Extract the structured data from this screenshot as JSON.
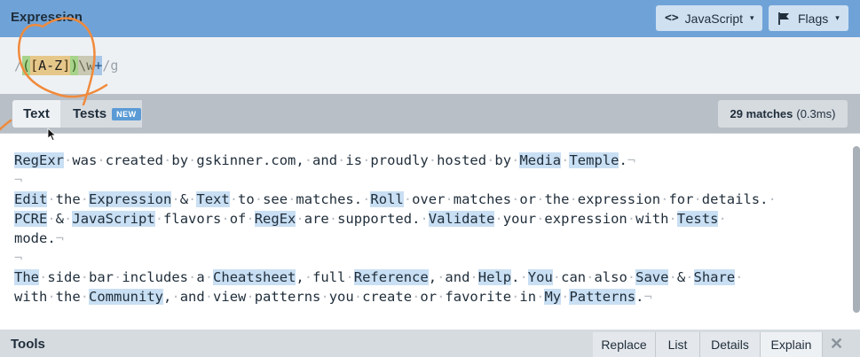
{
  "header": {
    "title": "Expression",
    "language_icon": "code-icon",
    "language_label": "JavaScript",
    "flags_icon": "flag-icon",
    "flags_label": "Flags",
    "caret": "▾"
  },
  "expression": {
    "open_delim": "/",
    "group_open": "(",
    "set_open": "[",
    "range": "A-Z",
    "set_close": "]",
    "group_close": ")",
    "word_class": "\\w",
    "quantifier": "+",
    "close_delim": "/g"
  },
  "tabs": {
    "text": "Text",
    "tests": "Tests",
    "tests_badge": "NEW",
    "match_count": "29 matches",
    "match_time": "(0.3ms)"
  },
  "text_lines": [
    [
      {
        "t": "RegExr",
        "h": true
      },
      {
        "t": "·"
      },
      {
        "t": "was"
      },
      {
        "t": "·"
      },
      {
        "t": "created"
      },
      {
        "t": "·"
      },
      {
        "t": "by"
      },
      {
        "t": "·"
      },
      {
        "t": "gskinner.com,"
      },
      {
        "t": "·"
      },
      {
        "t": "and"
      },
      {
        "t": "·"
      },
      {
        "t": "is"
      },
      {
        "t": "·"
      },
      {
        "t": "proudly"
      },
      {
        "t": "·"
      },
      {
        "t": "hosted"
      },
      {
        "t": "·"
      },
      {
        "t": "by"
      },
      {
        "t": "·"
      },
      {
        "t": "Media",
        "h": true
      },
      {
        "t": "·"
      },
      {
        "t": "Temple",
        "h": true
      },
      {
        "t": "."
      },
      {
        "t": "¬",
        "w": true
      }
    ],
    [
      {
        "t": "¬",
        "w": true
      }
    ],
    [
      {
        "t": "Edit",
        "h": true
      },
      {
        "t": "·"
      },
      {
        "t": "the"
      },
      {
        "t": "·"
      },
      {
        "t": "Expression",
        "h": true
      },
      {
        "t": "·"
      },
      {
        "t": "&"
      },
      {
        "t": "·"
      },
      {
        "t": "Text",
        "h": true
      },
      {
        "t": "·"
      },
      {
        "t": "to"
      },
      {
        "t": "·"
      },
      {
        "t": "see"
      },
      {
        "t": "·"
      },
      {
        "t": "matches."
      },
      {
        "t": "·"
      },
      {
        "t": "Roll",
        "h": true
      },
      {
        "t": "·"
      },
      {
        "t": "over"
      },
      {
        "t": "·"
      },
      {
        "t": "matches"
      },
      {
        "t": "·"
      },
      {
        "t": "or"
      },
      {
        "t": "·"
      },
      {
        "t": "the"
      },
      {
        "t": "·"
      },
      {
        "t": "expression"
      },
      {
        "t": "·"
      },
      {
        "t": "for"
      },
      {
        "t": "·"
      },
      {
        "t": "details."
      },
      {
        "t": "·"
      }
    ],
    [
      {
        "t": "PCRE",
        "h": true
      },
      {
        "t": "·"
      },
      {
        "t": "&"
      },
      {
        "t": "·"
      },
      {
        "t": "JavaScript",
        "h": true
      },
      {
        "t": "·"
      },
      {
        "t": "flavors"
      },
      {
        "t": "·"
      },
      {
        "t": "of"
      },
      {
        "t": "·"
      },
      {
        "t": "RegEx",
        "h": true
      },
      {
        "t": "·"
      },
      {
        "t": "are"
      },
      {
        "t": "·"
      },
      {
        "t": "supported."
      },
      {
        "t": "·"
      },
      {
        "t": "Validate",
        "h": true
      },
      {
        "t": "·"
      },
      {
        "t": "your"
      },
      {
        "t": "·"
      },
      {
        "t": "expression"
      },
      {
        "t": "·"
      },
      {
        "t": "with"
      },
      {
        "t": "·"
      },
      {
        "t": "Tests",
        "h": true
      },
      {
        "t": "·"
      }
    ],
    [
      {
        "t": "mode."
      },
      {
        "t": "¬",
        "w": true
      }
    ],
    [
      {
        "t": "¬",
        "w": true
      }
    ],
    [
      {
        "t": "The",
        "h": true
      },
      {
        "t": "·"
      },
      {
        "t": "side"
      },
      {
        "t": "·"
      },
      {
        "t": "bar"
      },
      {
        "t": "·"
      },
      {
        "t": "includes"
      },
      {
        "t": "·"
      },
      {
        "t": "a"
      },
      {
        "t": "·"
      },
      {
        "t": "Cheatsheet",
        "h": true
      },
      {
        "t": ","
      },
      {
        "t": "·"
      },
      {
        "t": "full"
      },
      {
        "t": "·"
      },
      {
        "t": "Reference",
        "h": true
      },
      {
        "t": ","
      },
      {
        "t": "·"
      },
      {
        "t": "and"
      },
      {
        "t": "·"
      },
      {
        "t": "Help",
        "h": true
      },
      {
        "t": "."
      },
      {
        "t": "·"
      },
      {
        "t": "You",
        "h": true
      },
      {
        "t": "·"
      },
      {
        "t": "can"
      },
      {
        "t": "·"
      },
      {
        "t": "also"
      },
      {
        "t": "·"
      },
      {
        "t": "Save",
        "h": true
      },
      {
        "t": "·"
      },
      {
        "t": "&"
      },
      {
        "t": "·"
      },
      {
        "t": "Share",
        "h": true
      },
      {
        "t": "·"
      }
    ],
    [
      {
        "t": "with"
      },
      {
        "t": "·"
      },
      {
        "t": "the"
      },
      {
        "t": "·"
      },
      {
        "t": "Community",
        "h": true
      },
      {
        "t": ","
      },
      {
        "t": "·"
      },
      {
        "t": "and"
      },
      {
        "t": "·"
      },
      {
        "t": "view"
      },
      {
        "t": "·"
      },
      {
        "t": "patterns"
      },
      {
        "t": "·"
      },
      {
        "t": "you"
      },
      {
        "t": "·"
      },
      {
        "t": "create"
      },
      {
        "t": "·"
      },
      {
        "t": "or"
      },
      {
        "t": "·"
      },
      {
        "t": "favorite"
      },
      {
        "t": "·"
      },
      {
        "t": "in"
      },
      {
        "t": "·"
      },
      {
        "t": "My",
        "h": true
      },
      {
        "t": "·"
      },
      {
        "t": "Patterns",
        "h": true
      },
      {
        "t": "."
      },
      {
        "t": "¬",
        "w": true
      }
    ]
  ],
  "tools": {
    "title": "Tools",
    "tabs": [
      "Replace",
      "List",
      "Details",
      "Explain"
    ],
    "active_tab": "Explain",
    "close_icon": "close-icon",
    "close_glyph": "✕"
  },
  "colors": {
    "header_bg": "#6fa3d8",
    "match_highlight": "#c9dff3",
    "annotation_stroke": "#f08a3c"
  }
}
